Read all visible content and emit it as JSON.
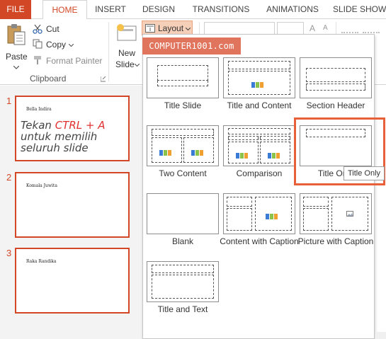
{
  "ribbon_tabs": [
    "FILE",
    "HOME",
    "INSERT",
    "DESIGN",
    "TRANSITIONS",
    "ANIMATIONS",
    "SLIDE SHOW"
  ],
  "clipboard": {
    "paste": "Paste",
    "cut": "Cut",
    "copy": "Copy",
    "format_painter": "Format Painter",
    "group_label": "Clipboard"
  },
  "slides_group": {
    "new_slide_line1": "New",
    "new_slide_line2": "Slide",
    "layout_button": "Layout"
  },
  "watermark": "COMPUTER1001.com",
  "slides": [
    {
      "number": "1",
      "name": "Bella Indira"
    },
    {
      "number": "2",
      "name": "Komala Juwita"
    },
    {
      "number": "3",
      "name": "Raka Randika"
    }
  ],
  "annotation": {
    "line1_a": "Tekan ",
    "line1_b": "CTRL + A",
    "line2": "untuk memilih",
    "line3": "seluruh slide"
  },
  "layouts": [
    {
      "label": "Title Slide"
    },
    {
      "label": "Title and Content"
    },
    {
      "label": "Section Header"
    },
    {
      "label": "Two Content"
    },
    {
      "label": "Comparison"
    },
    {
      "label": "Title Only"
    },
    {
      "label": "Blank"
    },
    {
      "label": "Content with Caption"
    },
    {
      "label": "Picture with Caption"
    },
    {
      "label": "Title and Text"
    }
  ],
  "tooltip": "Title Only",
  "colors": {
    "accent": "#d24726",
    "highlight": "#e8603a",
    "watermark_bg": "#e0745c"
  }
}
